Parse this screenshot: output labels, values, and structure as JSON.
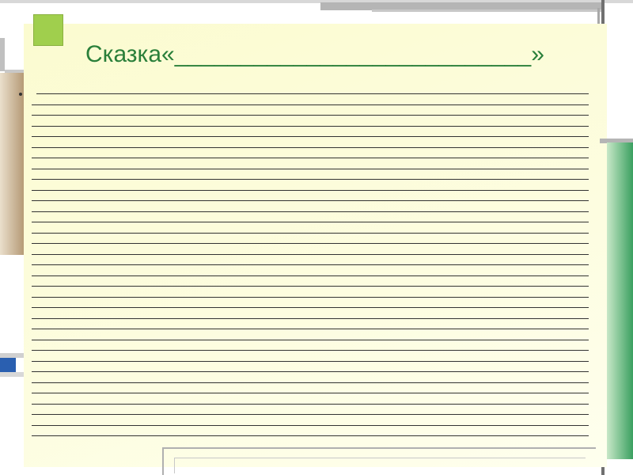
{
  "title": {
    "prefix": "Сказка«",
    "blank": "___________________________",
    "suffix": "»"
  },
  "lines": {
    "count": 33
  }
}
